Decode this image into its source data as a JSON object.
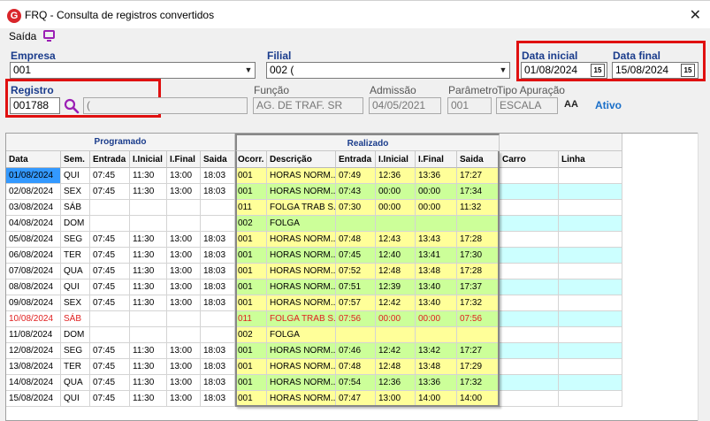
{
  "window": {
    "title": "FRQ - Consulta de registros convertidos",
    "app_letter": "G"
  },
  "menu": {
    "saida": "Saída"
  },
  "empresa": {
    "label": "Empresa",
    "value": "001"
  },
  "filial": {
    "label": "Filial",
    "value": "002 ("
  },
  "data_inicial": {
    "label": "Data inicial",
    "value": "01/08/2024",
    "btn": "15"
  },
  "data_final": {
    "label": "Data final",
    "value": "15/08/2024",
    "btn": "15"
  },
  "registro": {
    "label": "Registro",
    "value": "001788",
    "name_value": "("
  },
  "funcao": {
    "label": "Função",
    "value": "AG. DE TRAF. SR"
  },
  "admissao": {
    "label": "Admissão",
    "value": "04/05/2021"
  },
  "parametro": {
    "label": "Parâmetro",
    "value": "001"
  },
  "tipo_apuracao": {
    "label": "Tipo Apuração",
    "value": "ESCALA"
  },
  "status": {
    "value": "Ativo"
  },
  "az_icon": "AA",
  "grid": {
    "groups": {
      "programado": "Programado",
      "realizado": "Realizado"
    },
    "columns": [
      "Data",
      "Sem.",
      "Entrada",
      "I.Inicial",
      "I.Final",
      "Saida",
      "Ocorr.",
      "Descrição",
      "Entrada",
      "I.Inicial",
      "I.Final",
      "Saida",
      "Carro",
      "Linha"
    ],
    "rows": [
      [
        "01/08/2024",
        "QUI",
        "07:45",
        "11:30",
        "13:00",
        "18:03",
        "001",
        "HORAS NORM...",
        "07:49",
        "12:36",
        "13:36",
        "17:27",
        "",
        ""
      ],
      [
        "02/08/2024",
        "SEX",
        "07:45",
        "11:30",
        "13:00",
        "18:03",
        "001",
        "HORAS NORM...",
        "07:43",
        "00:00",
        "00:00",
        "17:34",
        "",
        ""
      ],
      [
        "03/08/2024",
        "SÁB",
        "",
        "",
        "",
        "",
        "011",
        "FOLGA TRAB S...",
        "07:30",
        "00:00",
        "00:00",
        "11:32",
        "",
        ""
      ],
      [
        "04/08/2024",
        "DOM",
        "",
        "",
        "",
        "",
        "002",
        "FOLGA",
        "",
        "",
        "",
        "",
        "",
        ""
      ],
      [
        "05/08/2024",
        "SEG",
        "07:45",
        "11:30",
        "13:00",
        "18:03",
        "001",
        "HORAS NORM...",
        "07:48",
        "12:43",
        "13:43",
        "17:28",
        "",
        ""
      ],
      [
        "06/08/2024",
        "TER",
        "07:45",
        "11:30",
        "13:00",
        "18:03",
        "001",
        "HORAS NORM...",
        "07:45",
        "12:40",
        "13:41",
        "17:30",
        "",
        ""
      ],
      [
        "07/08/2024",
        "QUA",
        "07:45",
        "11:30",
        "13:00",
        "18:03",
        "001",
        "HORAS NORM...",
        "07:52",
        "12:48",
        "13:48",
        "17:28",
        "",
        ""
      ],
      [
        "08/08/2024",
        "QUI",
        "07:45",
        "11:30",
        "13:00",
        "18:03",
        "001",
        "HORAS NORM...",
        "07:51",
        "12:39",
        "13:40",
        "17:37",
        "",
        ""
      ],
      [
        "09/08/2024",
        "SEX",
        "07:45",
        "11:30",
        "13:00",
        "18:03",
        "001",
        "HORAS NORM...",
        "07:57",
        "12:42",
        "13:40",
        "17:32",
        "",
        ""
      ],
      [
        "10/08/2024",
        "SÁB",
        "",
        "",
        "",
        "",
        "011",
        "FOLGA TRAB S...",
        "07:56",
        "00:00",
        "00:00",
        "07:56",
        "",
        ""
      ],
      [
        "11/08/2024",
        "DOM",
        "",
        "",
        "",
        "",
        "002",
        "FOLGA",
        "",
        "",
        "",
        "",
        "",
        ""
      ],
      [
        "12/08/2024",
        "SEG",
        "07:45",
        "11:30",
        "13:00",
        "18:03",
        "001",
        "HORAS NORM...",
        "07:46",
        "12:42",
        "13:42",
        "17:27",
        "",
        ""
      ],
      [
        "13/08/2024",
        "TER",
        "07:45",
        "11:30",
        "13:00",
        "18:03",
        "001",
        "HORAS NORM...",
        "07:48",
        "12:48",
        "13:48",
        "17:29",
        "",
        ""
      ],
      [
        "14/08/2024",
        "QUA",
        "07:45",
        "11:30",
        "13:00",
        "18:03",
        "001",
        "HORAS NORM...",
        "07:54",
        "12:36",
        "13:36",
        "17:32",
        "",
        ""
      ],
      [
        "15/08/2024",
        "QUI",
        "07:45",
        "11:30",
        "13:00",
        "18:03",
        "001",
        "HORAS NORM...",
        "07:47",
        "13:00",
        "14:00",
        "14:00",
        "",
        ""
      ]
    ],
    "highlight_row": 9,
    "selected_row": 0
  },
  "colors": {
    "realizado_odd": "#ffff99",
    "realizado_even": "#ccff99",
    "extra_odd": "#ffffff",
    "extra_even": "#ccffff",
    "highlight_text": "#e02020",
    "selected_bg": "#3399ff",
    "field_label": "#1a3c8c",
    "red_box": "#e01010"
  }
}
